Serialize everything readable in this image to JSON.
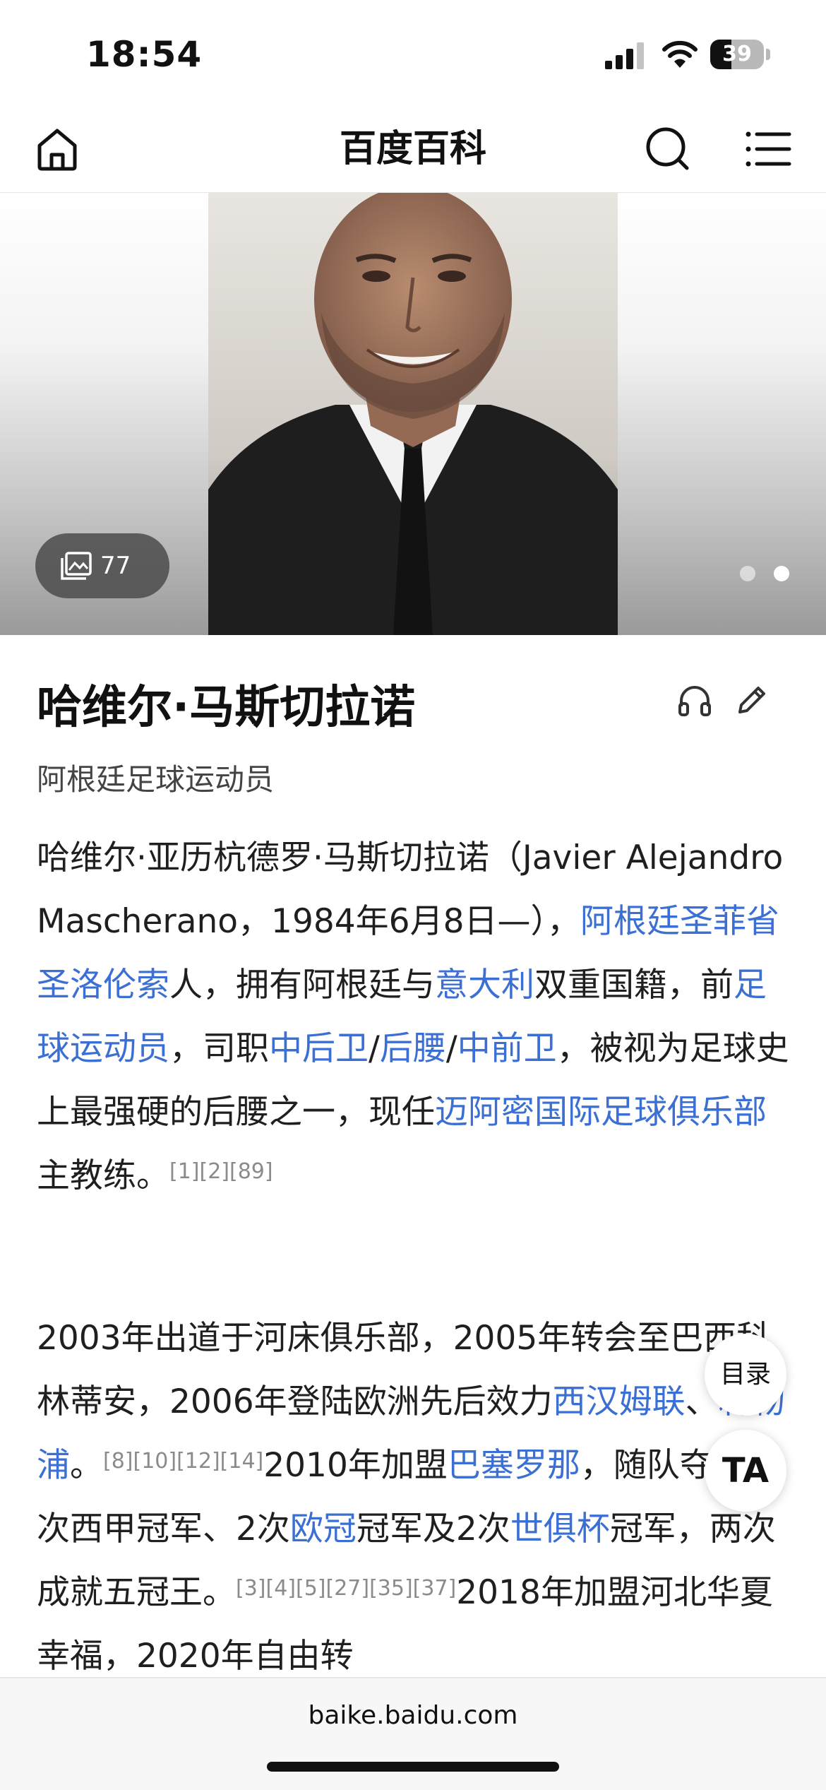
{
  "status_bar": {
    "time": "18:54",
    "battery_percent": "39"
  },
  "nav": {
    "title": "百度百科",
    "icons": [
      "home-icon",
      "search-icon",
      "menu-icon"
    ]
  },
  "hero": {
    "photo_count": "77",
    "carousel_pages": 2,
    "active_page": 2
  },
  "entry": {
    "title": "哈维尔·马斯切拉诺",
    "subtitle": "阿根廷足球运动员",
    "para1": {
      "t1": "哈维尔·亚历杭德罗·马斯切拉诺（Javier Alejandro Mascherano，1984年6月8日—），",
      "l1": "阿根廷圣菲省圣洛伦索",
      "t2": "人，拥有阿根廷与",
      "l2": "意大利",
      "t3": "双重国籍，前",
      "l3": "足球运动员",
      "t4": "，司职",
      "l4": "中后卫",
      "s1": "/",
      "l5": "后腰",
      "s2": "/",
      "l6": "中前卫",
      "t5": "，被视为足球史上最强硬的后腰之一，现任",
      "l7": "迈阿密国际足球俱乐部",
      "t6": "主教练。",
      "r1": "[1][2][89]"
    },
    "para2": {
      "t1": "2003年出道于河床俱乐部，2005年转会至巴西科林蒂安，2006年登陆欧洲先后效力",
      "l1": "西汉姆联",
      "t2": "、",
      "l2": "利物浦",
      "t3": "。",
      "r1": "[8][10][12][14]",
      "t4": "2010年加盟",
      "l3": "巴塞罗那",
      "t5": "，随队夺得5次西甲冠军、2次",
      "l4": "欧冠",
      "t6": "冠军及2次",
      "l5": "世俱杯",
      "t7": "冠军，两次成就五冠王。",
      "r2": "[3][4][5][27][35][37]",
      "t8": "2018年加盟河北华夏幸福，2020年自由转"
    }
  },
  "floating": {
    "toc": "目录",
    "ta": "TA"
  },
  "bottom": {
    "url": "baike.baidu.com"
  },
  "colors": {
    "link": "#3b6fd3",
    "ref": "#8b8b8b",
    "text": "#1f1f1f"
  }
}
